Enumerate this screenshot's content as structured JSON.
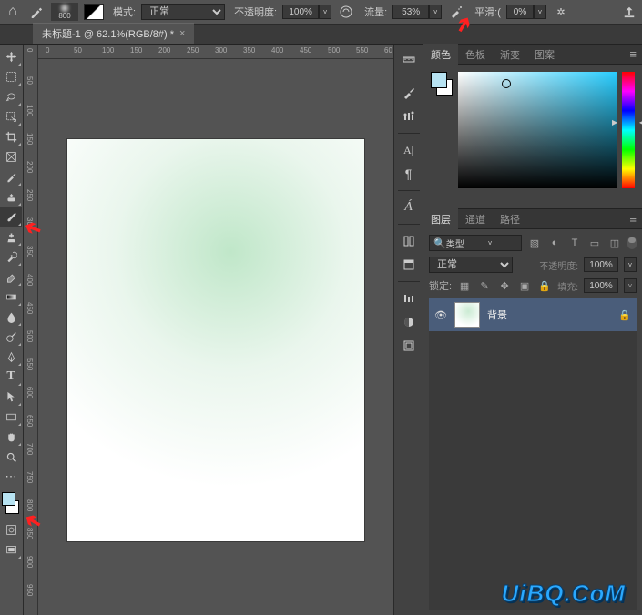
{
  "optionBar": {
    "brushSize": "800",
    "modeLabel": "模式:",
    "modeValue": "正常",
    "opacityLabel": "不透明度:",
    "opacityValue": "100%",
    "flowLabel": "流量:",
    "flowValue": "53%",
    "smoothingLabel": "平滑:(",
    "smoothingValue": "0%"
  },
  "docTab": {
    "title": "未标题-1 @ 62.1%(RGB/8#) *",
    "close": "×"
  },
  "hRulerTicks": [
    "0",
    "50",
    "100",
    "150",
    "200",
    "250",
    "300",
    "350",
    "400",
    "450",
    "500",
    "550",
    "60"
  ],
  "vRulerTicks": [
    "0",
    "50",
    "100",
    "150",
    "200",
    "250",
    "300",
    "350",
    "400",
    "450",
    "500",
    "550",
    "600",
    "650",
    "700",
    "750",
    "800",
    "850",
    "900",
    "950"
  ],
  "panels": {
    "color": {
      "tabs": [
        "颜色",
        "色板",
        "渐变",
        "图案"
      ]
    },
    "layers": {
      "tabs": [
        "图层",
        "通道",
        "路径"
      ],
      "filterType": "类型",
      "blendMode": "正常",
      "opacityLabel": "不透明度:",
      "opacityValue": "100%",
      "lockLabel": "锁定:",
      "fillLabel": "填充:",
      "fillValue": "100%",
      "items": [
        {
          "name": "背景",
          "locked": true
        }
      ]
    }
  },
  "watermark": "UiBQ.CoM"
}
